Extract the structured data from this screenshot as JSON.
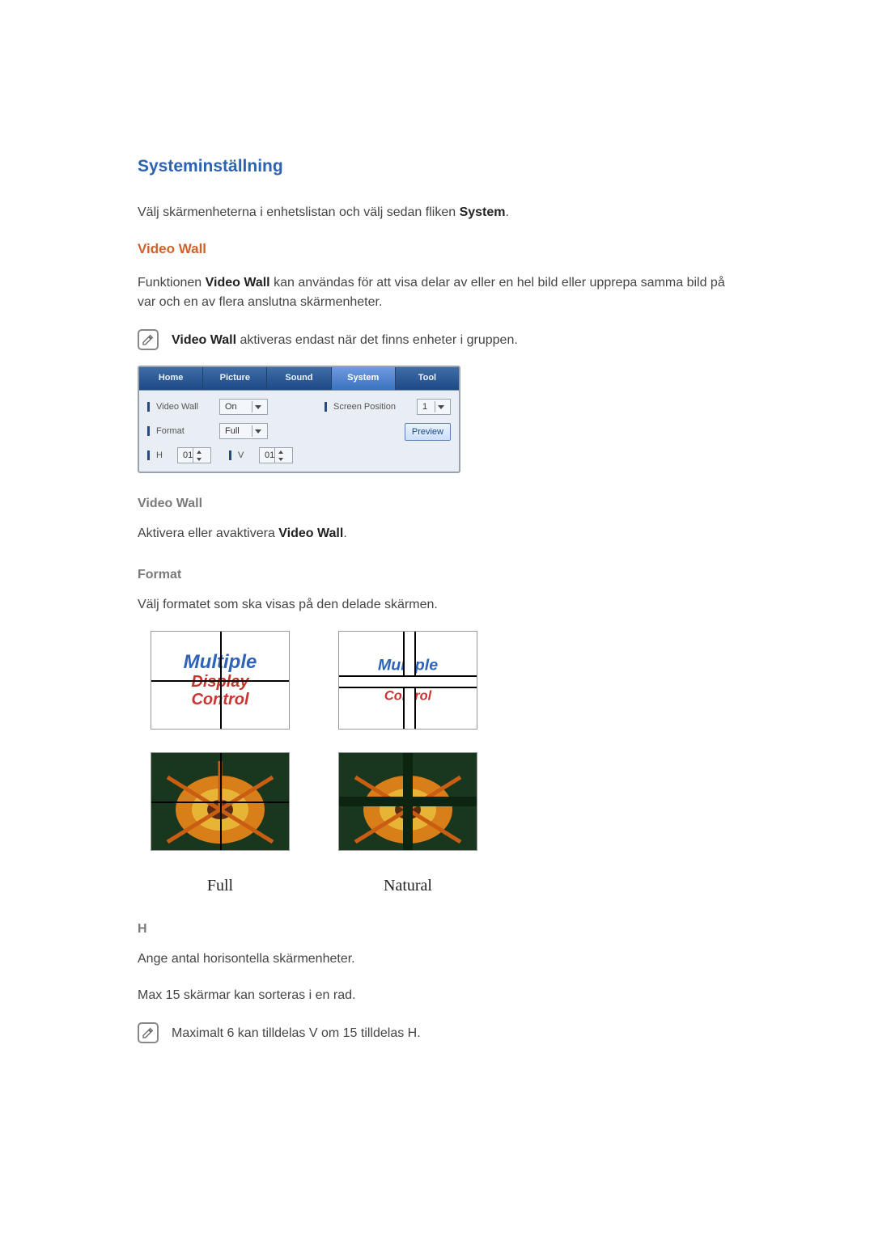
{
  "headings": {
    "main": "Systeminställning",
    "sub1": "Video Wall",
    "video_wall_h": "Video Wall",
    "format_h": "Format",
    "h_h": "H"
  },
  "paras": {
    "intro_pre": "Välj skärmenheterna i enhetslistan och välj sedan fliken ",
    "intro_bold": "System",
    "intro_post": ".",
    "func_pre": "Funktionen ",
    "func_bold": "Video Wall",
    "func_post": " kan användas för att visa delar av eller en hel bild eller upprepa samma bild på var och en av flera anslutna skärmenheter.",
    "note1_bold": "Video Wall",
    "note1_rest": " aktiveras endast när det finns enheter i gruppen.",
    "vw_pre": "Aktivera eller avaktivera ",
    "vw_bold": "Video Wall",
    "vw_post": ".",
    "format_p": "Välj formatet som ska visas på den delade skärmen.",
    "h_p1": "Ange antal horisontella skärmenheter.",
    "h_p2": "Max 15 skärmar kan sorteras i en rad.",
    "note2": "Maximalt 6 kan tilldelas V om 15 tilldelas H."
  },
  "panel": {
    "tabs": [
      "Home",
      "Picture",
      "Sound",
      "System",
      "Tool"
    ],
    "videoWallLabel": "Video Wall",
    "videoWallValue": "On",
    "formatLabel": "Format",
    "formatValue": "Full",
    "hLabel": "H",
    "hValue": "01",
    "vLabel": "V",
    "vValue": "01",
    "screenPosLabel": "Screen Position",
    "screenPosValue": "1",
    "previewLabel": "Preview"
  },
  "thumbText": {
    "l1": "Multiple",
    "l2": "Display",
    "l3": "Control"
  },
  "captions": {
    "full": "Full",
    "natural": "Natural"
  }
}
